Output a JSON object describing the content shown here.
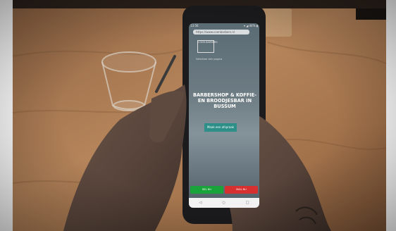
{
  "phone": {
    "status_time": "13:56",
    "status_icons": "▾ ◢ 44% ▮",
    "url": "https://www.coenbarbers.nl",
    "logo_text": "COEN BARBERS",
    "menu_label": "Selecteer een pagina",
    "headline_faded": "BARBERSHOP & KOFFIE- EN",
    "headline": "BARBERSHOP & KOFFIE- EN BROODJESBAR IN BUSSUM",
    "cta_button": "Maak een afspraak",
    "bottom_call": "BEL NU",
    "bottom_mail": "MAIL NU",
    "nav_back": "◁",
    "nav_home": "○",
    "nav_recent": "□"
  },
  "colors": {
    "wood": "#a8774f",
    "call_button": "#1aa33a",
    "mail_button": "#d63030",
    "cta": "#2e8f88"
  }
}
